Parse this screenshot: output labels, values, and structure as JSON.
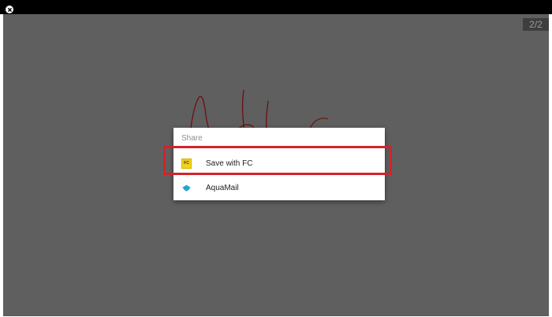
{
  "window": {
    "close_label": "close"
  },
  "canvas": {
    "page_indicator": "2/2"
  },
  "share_dialog": {
    "title": "Share",
    "items": [
      {
        "label": "Save with FC",
        "icon": "fc-app-icon",
        "icon_text": "FC"
      },
      {
        "label": "AquaMail",
        "icon": "aquamail-icon"
      }
    ]
  },
  "colors": {
    "canvas_bg": "#5f5f5f",
    "stroke": "#6b1010",
    "highlight": "#d2232a"
  }
}
